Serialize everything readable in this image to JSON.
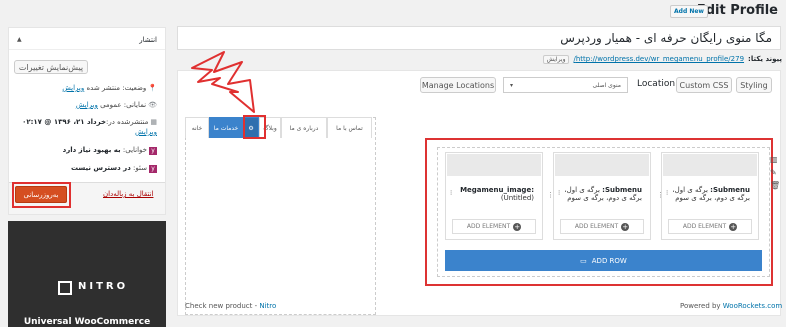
{
  "header": {
    "title": "Edit Profile",
    "add_new_label": "Add New"
  },
  "post": {
    "title_value": "مگا منوی رایگان حرفه ای - همیار وردپرس",
    "permalink_label": "پیوند یکتا:",
    "permalink_url": "http://wordpress.dev/wr_megamenu_profile/279/",
    "permalink_edit": "ویرایش"
  },
  "publish": {
    "title": "انتشار",
    "preview_label": "پیش‌نمایش تغییرات",
    "status": {
      "label": "وضعیت:",
      "value": "منتشر شده",
      "edit": "ویرایش"
    },
    "visibility": {
      "label": "نمایانی:",
      "value": "عمومی",
      "edit": "ویرایش"
    },
    "published": {
      "label": "منتشرشده در:",
      "value": "خرداد ۲۱، ۱۳۹۶ @ ۰۲:۱۷",
      "edit": "ویرایش"
    },
    "readability": {
      "label": "خوانایی:",
      "value": "به بهبود نیاز دارد"
    },
    "seo": {
      "label": "سئو:",
      "value": "در دسترس نیست"
    },
    "update_label": "به‌روزرسانی",
    "trash_label": "انتقال به زباله‌دان"
  },
  "ad": {
    "brand": "NITRO",
    "tagline": "Universal WooCommerce"
  },
  "toolbar": {
    "styling_label": "Styling",
    "custom_css_label": "Custom CSS",
    "location_label": "Location",
    "location_value": "منوی اصلی",
    "manage_locations_label": "Manage Locations"
  },
  "tabs": [
    {
      "label": "خانه",
      "active": false
    },
    {
      "label": "خدمات ما",
      "active": true
    },
    {
      "label": "وبلاگ",
      "active": false
    },
    {
      "label": "درباره ی ما",
      "active": false
    },
    {
      "label": "تماس با ما",
      "active": false
    }
  ],
  "columns": [
    {
      "title": "Submenu:",
      "text": "برگه ی اول، برگه ی دوم، برگه ی سوم"
    },
    {
      "title": "Submenu:",
      "text": "برگه ی اول، برگه ی دوم، برگه ی سوم"
    },
    {
      "title": "Megamenu_image:",
      "text": "(Untitled)"
    }
  ],
  "add_element_label": "ADD ELEMENT",
  "add_row_label": "ADD ROW",
  "footer": {
    "left_text": "Check new product - ",
    "left_link": "Nitro",
    "right_text": "Powered by ",
    "right_link": "WooRockets.com"
  },
  "colors": {
    "accent_blue": "#3b83cc",
    "highlight_red": "#e03030",
    "update_orange": "#d54e21"
  }
}
